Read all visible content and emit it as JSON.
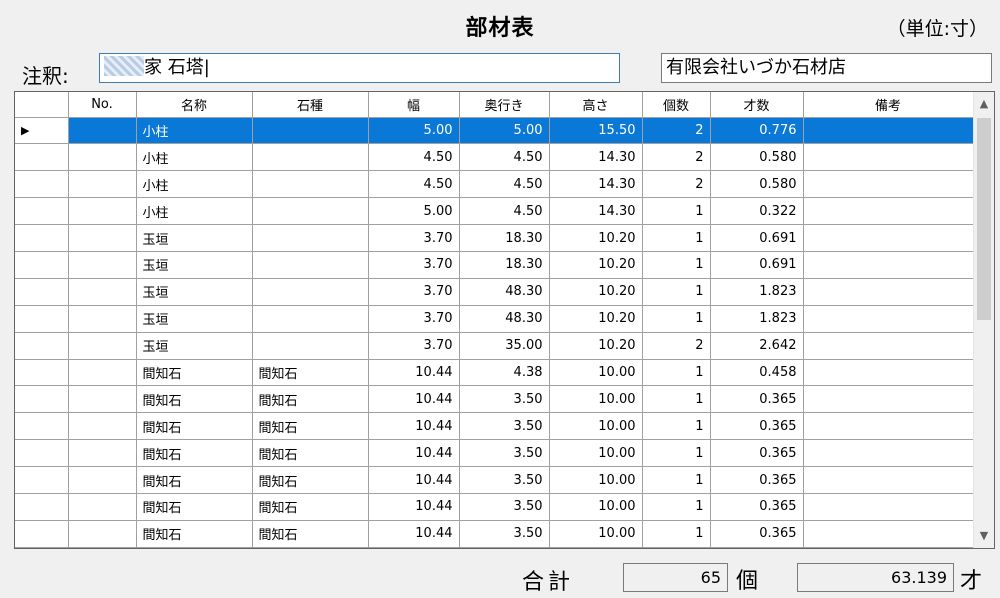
{
  "header": {
    "title": "部材表",
    "unit": "（単位:寸）"
  },
  "note": {
    "label": "注釈:",
    "value": "家 石塔|"
  },
  "company": {
    "value": "有限会社いづか石材店"
  },
  "grid": {
    "columns": [
      "No.",
      "名称",
      "石種",
      "幅",
      "奥行き",
      "高さ",
      "個数",
      "才数",
      "備考"
    ],
    "selected_marker": "▶",
    "rows": [
      {
        "no": "",
        "name": "小柱",
        "stone": "",
        "w": "5.00",
        "d": "5.00",
        "h": "15.50",
        "qty": "2",
        "sai": "0.776",
        "note": ""
      },
      {
        "no": "",
        "name": "小柱",
        "stone": "",
        "w": "4.50",
        "d": "4.50",
        "h": "14.30",
        "qty": "2",
        "sai": "0.580",
        "note": ""
      },
      {
        "no": "",
        "name": "小柱",
        "stone": "",
        "w": "4.50",
        "d": "4.50",
        "h": "14.30",
        "qty": "2",
        "sai": "0.580",
        "note": ""
      },
      {
        "no": "",
        "name": "小柱",
        "stone": "",
        "w": "5.00",
        "d": "4.50",
        "h": "14.30",
        "qty": "1",
        "sai": "0.322",
        "note": ""
      },
      {
        "no": "",
        "name": "玉垣",
        "stone": "",
        "w": "3.70",
        "d": "18.30",
        "h": "10.20",
        "qty": "1",
        "sai": "0.691",
        "note": ""
      },
      {
        "no": "",
        "name": "玉垣",
        "stone": "",
        "w": "3.70",
        "d": "18.30",
        "h": "10.20",
        "qty": "1",
        "sai": "0.691",
        "note": ""
      },
      {
        "no": "",
        "name": "玉垣",
        "stone": "",
        "w": "3.70",
        "d": "48.30",
        "h": "10.20",
        "qty": "1",
        "sai": "1.823",
        "note": ""
      },
      {
        "no": "",
        "name": "玉垣",
        "stone": "",
        "w": "3.70",
        "d": "48.30",
        "h": "10.20",
        "qty": "1",
        "sai": "1.823",
        "note": ""
      },
      {
        "no": "",
        "name": "玉垣",
        "stone": "",
        "w": "3.70",
        "d": "35.00",
        "h": "10.20",
        "qty": "2",
        "sai": "2.642",
        "note": ""
      },
      {
        "no": "",
        "name": "間知石",
        "stone": "間知石",
        "w": "10.44",
        "d": "4.38",
        "h": "10.00",
        "qty": "1",
        "sai": "0.458",
        "note": ""
      },
      {
        "no": "",
        "name": "間知石",
        "stone": "間知石",
        "w": "10.44",
        "d": "3.50",
        "h": "10.00",
        "qty": "1",
        "sai": "0.365",
        "note": ""
      },
      {
        "no": "",
        "name": "間知石",
        "stone": "間知石",
        "w": "10.44",
        "d": "3.50",
        "h": "10.00",
        "qty": "1",
        "sai": "0.365",
        "note": ""
      },
      {
        "no": "",
        "name": "間知石",
        "stone": "間知石",
        "w": "10.44",
        "d": "3.50",
        "h": "10.00",
        "qty": "1",
        "sai": "0.365",
        "note": ""
      },
      {
        "no": "",
        "name": "間知石",
        "stone": "間知石",
        "w": "10.44",
        "d": "3.50",
        "h": "10.00",
        "qty": "1",
        "sai": "0.365",
        "note": ""
      },
      {
        "no": "",
        "name": "間知石",
        "stone": "間知石",
        "w": "10.44",
        "d": "3.50",
        "h": "10.00",
        "qty": "1",
        "sai": "0.365",
        "note": ""
      },
      {
        "no": "",
        "name": "間知石",
        "stone": "間知石",
        "w": "10.44",
        "d": "3.50",
        "h": "10.00",
        "qty": "1",
        "sai": "0.365",
        "note": ""
      }
    ],
    "scroll_up_icon": "▲",
    "scroll_down_icon": "▼"
  },
  "totals": {
    "label": "合計",
    "count": "65",
    "count_unit": "個",
    "size": "63.139",
    "size_unit": "才"
  },
  "colors": {
    "selection": "#0a78d7",
    "background": "#f0f0f0",
    "input_focus_border": "#3c7fb1"
  }
}
